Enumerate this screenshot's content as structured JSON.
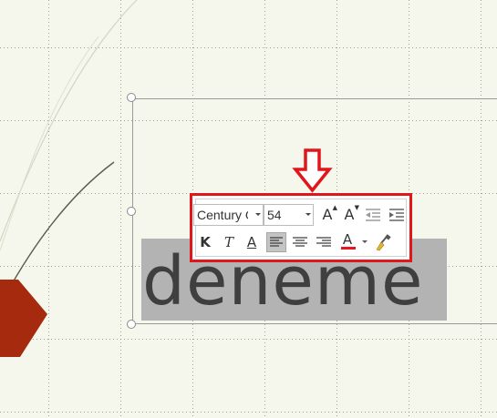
{
  "slide": {
    "body_text": "deneme",
    "colors": {
      "background": "#f5f6ec",
      "accent_shape": "#a52a0e",
      "selection": "#b3b3b3",
      "highlight_box": "#e0161b",
      "arrow": "#e0161b"
    }
  },
  "mini_toolbar": {
    "font_name": "Century G",
    "font_size": "54",
    "buttons": {
      "grow_font": "A",
      "shrink_font": "A",
      "bold": "K",
      "italic": "T",
      "text_shadow": "A",
      "font_color": "A"
    },
    "font_color_value": "#e8161b",
    "icons": {
      "grow": "grow-font-icon",
      "shrink": "shrink-font-icon",
      "decrease_indent": "decrease-indent-icon",
      "increase_indent": "increase-indent-icon",
      "align_left": "align-left-icon",
      "align_center": "align-center-icon",
      "align_right": "align-right-icon",
      "format_painter": "format-painter-icon"
    },
    "active_alignment": "left"
  }
}
